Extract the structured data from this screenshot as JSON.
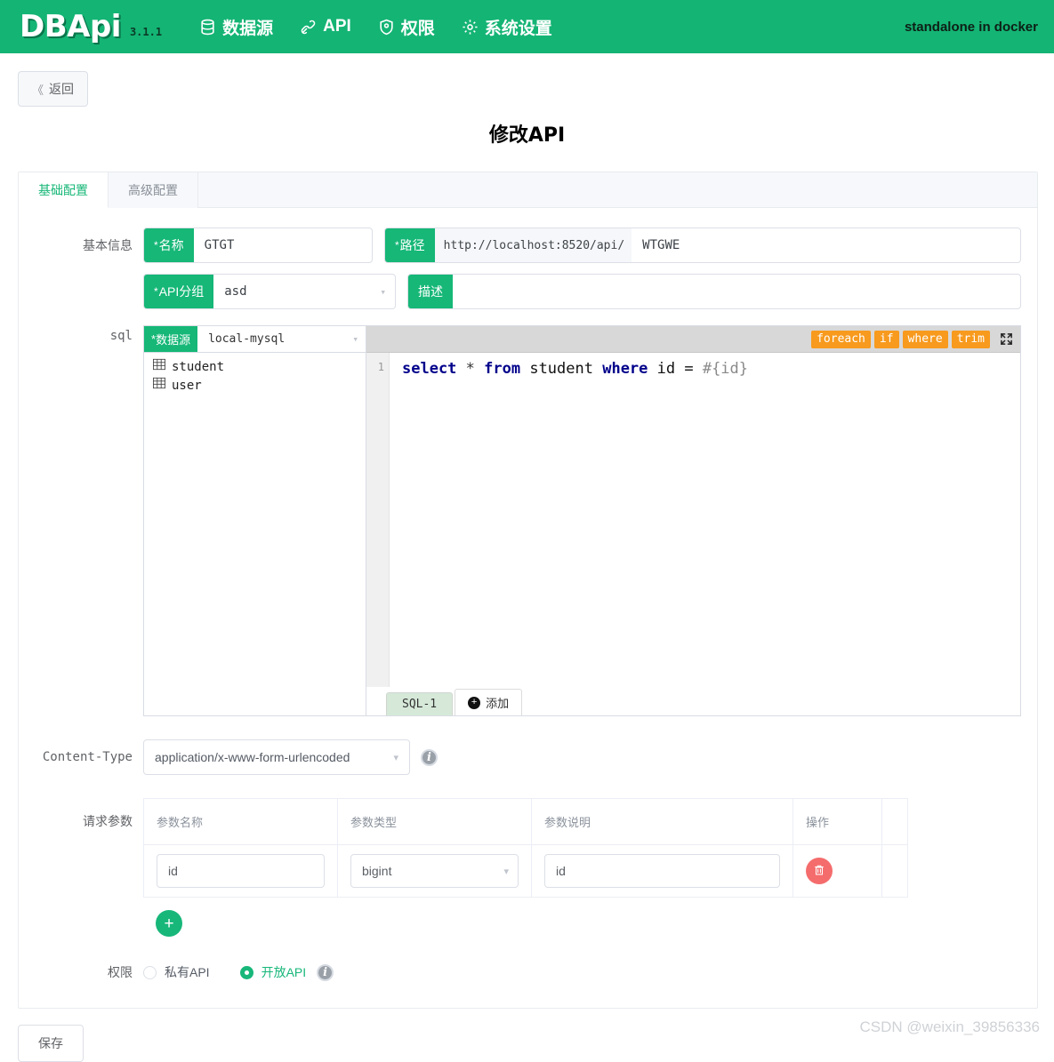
{
  "navbar": {
    "brand": "DBApi",
    "version": "3.1.1",
    "items": [
      {
        "label": "数据源",
        "icon": "database-icon"
      },
      {
        "label": "API",
        "icon": "api-link-icon"
      },
      {
        "label": "权限",
        "icon": "shield-icon"
      },
      {
        "label": "系统设置",
        "icon": "gear-icon"
      }
    ],
    "right_text": "standalone in docker",
    "brand_color": "#14b474"
  },
  "back_button": {
    "label": "返回",
    "chevron": "《"
  },
  "page_title": "修改API",
  "tabs": [
    {
      "label": "基础配置",
      "active": true
    },
    {
      "label": "高级配置",
      "active": false
    }
  ],
  "basic_info": {
    "row_label": "基本信息",
    "name": {
      "prefix": "名称",
      "required": true,
      "value": "GTGT"
    },
    "path": {
      "prefix": "路径",
      "required": true,
      "addon": "http://localhost:8520/api/",
      "value": "WTGWE"
    },
    "group": {
      "prefix": "API分组",
      "required": true,
      "value": "asd"
    },
    "description": {
      "prefix": "描述",
      "required": false,
      "value": ""
    }
  },
  "sql_section": {
    "row_label": "sql",
    "datasource": {
      "prefix": "数据源",
      "required": true,
      "value": "local-mysql"
    },
    "tables": [
      {
        "name": "student",
        "icon": "table-icon"
      },
      {
        "name": "user",
        "icon": "table-icon"
      }
    ],
    "toolbar_tags": [
      "foreach",
      "if",
      "where",
      "trim"
    ],
    "fullscreen_icon": "fullscreen-icon",
    "tag_color": "#f79a1e",
    "editor": {
      "line_number": "1",
      "code_tokens": [
        {
          "text": "select",
          "type": "keyword"
        },
        {
          "text": " * ",
          "type": "operator"
        },
        {
          "text": "from",
          "type": "keyword"
        },
        {
          "text": " student ",
          "type": "plain"
        },
        {
          "text": "where",
          "type": "keyword"
        },
        {
          "text": " id = ",
          "type": "plain"
        },
        {
          "text": "#{id}",
          "type": "param"
        }
      ],
      "code_text": "select * from student where id = #{id}"
    },
    "tabs": [
      {
        "label": "SQL-1",
        "active": true
      }
    ],
    "add_tab_label": "添加"
  },
  "content_type": {
    "label": "Content-Type",
    "value": "application/x-www-form-urlencoded",
    "info_icon": "info-icon"
  },
  "request_params": {
    "label": "请求参数",
    "columns": [
      "参数名称",
      "参数类型",
      "参数说明",
      "操作",
      ""
    ],
    "rows": [
      {
        "name": "id",
        "type": "bigint",
        "description": "id",
        "delete_icon": "trash-icon"
      }
    ],
    "add_button_icon": "plus-icon"
  },
  "permission": {
    "label": "权限",
    "options": [
      {
        "label": "私有API",
        "checked": false
      },
      {
        "label": "开放API",
        "checked": true
      }
    ],
    "info_icon": "info-icon",
    "accent_color": "#17b77a"
  },
  "save_button": {
    "label": "保存"
  },
  "watermark": "CSDN @weixin_39856336"
}
